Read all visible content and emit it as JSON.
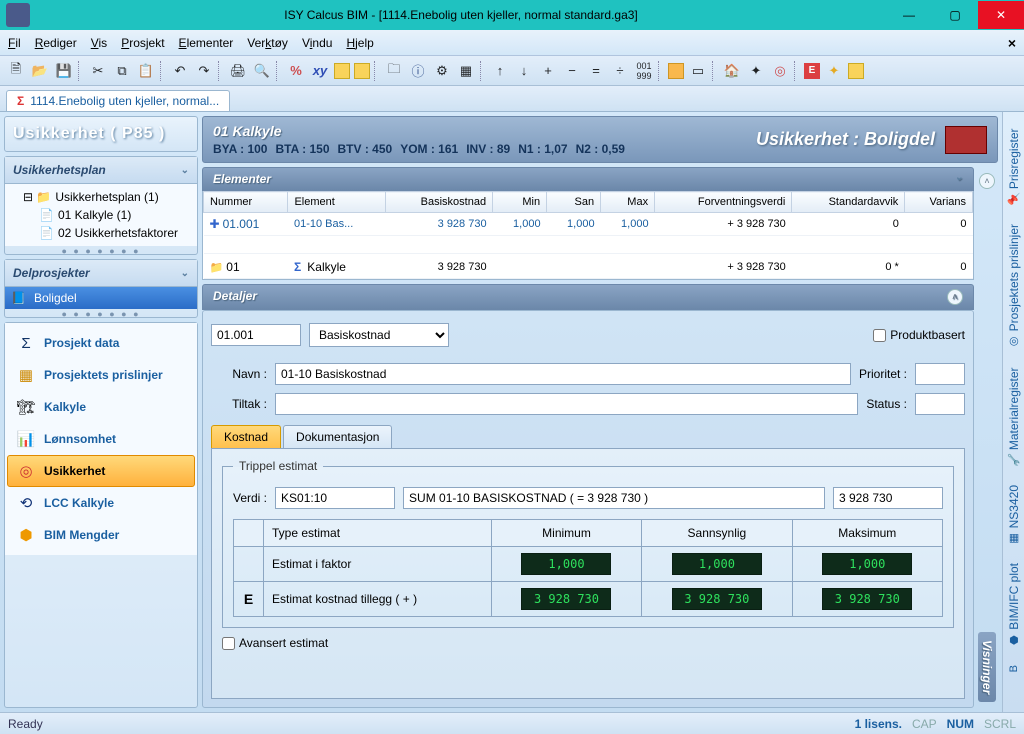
{
  "window": {
    "title": "ISY Calcus BIM - [1114.Enebolig uten kjeller, normal standard.ga3]"
  },
  "menu": {
    "fil": "Fil",
    "rediger": "Rediger",
    "vis": "Vis",
    "prosjekt": "Prosjekt",
    "elementer": "Elementer",
    "verktoy": "Verktøy",
    "vindu": "Vindu",
    "hjelp": "Hjelp"
  },
  "doctab": {
    "label": "1114.Enebolig uten kjeller, normal..."
  },
  "left": {
    "usikkerhet_hdr": "Usikkerhet ( P85 )",
    "plan_hdr": "Usikkerhetsplan",
    "tree": {
      "root": "Usikkerhetsplan (1)",
      "c1": "01 Kalkyle (1)",
      "c2": "02 Usikkerhetsfaktorer"
    },
    "delp_hdr": "Delprosjekter",
    "delp_item": "Boligdel",
    "nav": {
      "prosjekt": "Prosjekt data",
      "prislinjer": "Prosjektets prislinjer",
      "kalkyle": "Kalkyle",
      "lonn": "Lønnsomhet",
      "usikkerhet": "Usikkerhet",
      "lcc": "LCC Kalkyle",
      "bim": "BIM Mengder"
    }
  },
  "context": {
    "kalkyle_title": "01 Kalkyle",
    "stats": {
      "bya": "BYA : 100",
      "bta": "BTA : 150",
      "btv": "BTV : 450",
      "yom": "YOM : 161",
      "inv": "INV : 89",
      "n1": "N1 : 1,07",
      "n2": "N2 : 0,59"
    },
    "right_title": "Usikkerhet : Boligdel"
  },
  "elementer": {
    "hdr": "Elementer",
    "cols": {
      "nummer": "Nummer",
      "element": "Element",
      "basis": "Basiskostnad",
      "min": "Min",
      "san": "San",
      "max": "Max",
      "forv": "Forventningsverdi",
      "std": "Standardavvik",
      "var": "Varians"
    },
    "row": {
      "nummer": "01.001",
      "element": "01-10 Bas...",
      "basis": "3 928 730",
      "min": "1,000",
      "san": "1,000",
      "max": "1,000",
      "forv": "+ 3 928 730",
      "std": "0",
      "var": "0"
    },
    "sum": {
      "nummer": "01",
      "element": "Kalkyle",
      "basis": "3 928 730",
      "forv": "+ 3 928 730",
      "std": "0 *",
      "var": "0"
    }
  },
  "details": {
    "hdr": "Detaljer",
    "id": "01.001",
    "type": "Basiskostnad",
    "produktbasert": "Produktbasert",
    "navn_lbl": "Navn :",
    "navn": "01-10 Basiskostnad",
    "tiltak_lbl": "Tiltak :",
    "prioritet_lbl": "Prioritet :",
    "status_lbl": "Status :",
    "tabs": {
      "kostnad": "Kostnad",
      "dok": "Dokumentasjon"
    },
    "tripel_lbl": "Trippel estimat",
    "verdi_lbl": "Verdi :",
    "verdi": "KS01:10",
    "sumdesc": "SUM 01-10 BASISKOSTNAD ( = 3 928 730 )",
    "sumval": "3 928 730",
    "est_cols": {
      "type": "Type estimat",
      "min": "Minimum",
      "san": "Sannsynlig",
      "max": "Maksimum"
    },
    "est_r1": {
      "label": "Estimat i faktor",
      "min": "1,000",
      "san": "1,000",
      "max": "1,000"
    },
    "est_r2": {
      "mark": "E",
      "label": "Estimat kostnad tillegg ( + )",
      "min": "3 928 730",
      "san": "3 928 730",
      "max": "3 928 730"
    },
    "avansert": "Avansert estimat",
    "visninger": "Visninger"
  },
  "rightstrip": {
    "prisregister": "Prisregister",
    "prosjprislinjer": "Prosjektets prislinjer",
    "material": "Materialregister",
    "ns3420": "NS3420",
    "bimifc": "BIM/IFC plot"
  },
  "status": {
    "ready": "Ready",
    "lisens": "1 lisens.",
    "cap": "CAP",
    "num": "NUM",
    "scrl": "SCRL"
  }
}
